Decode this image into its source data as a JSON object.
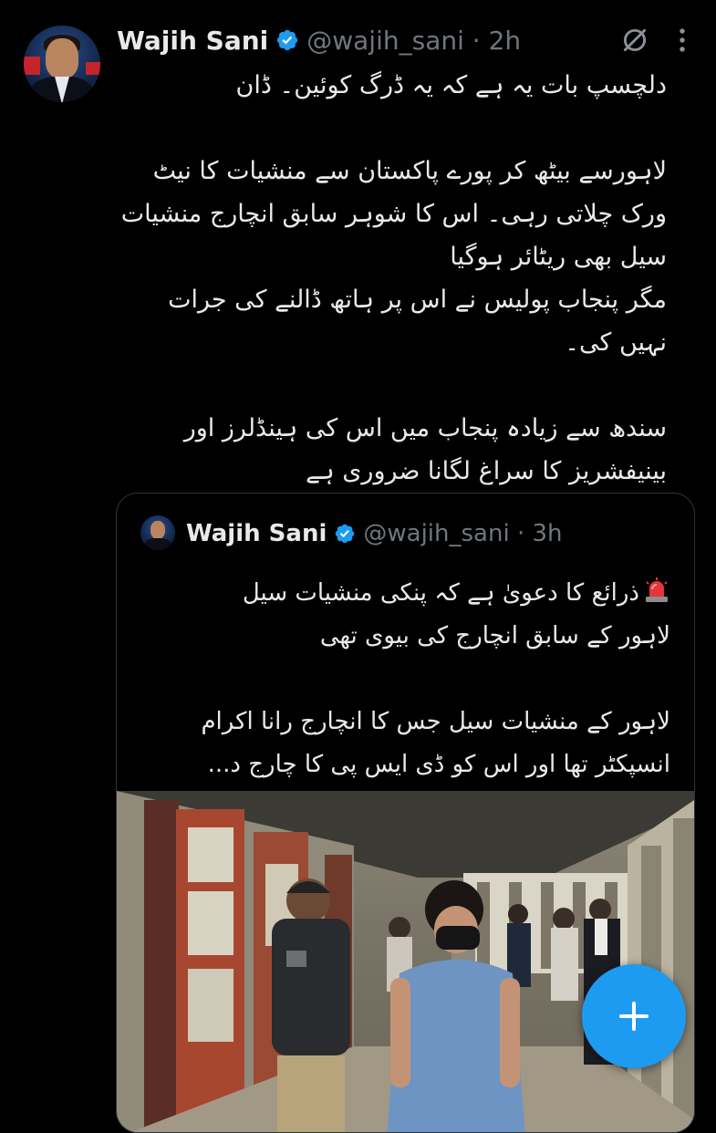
{
  "tweet": {
    "author_name": "Wajih Sani",
    "handle_time": "@wajih_sani · 2h",
    "body": [
      "دلچسپ بات یہ ہے کہ یہ ڈرگ کوئین۔ ڈان",
      "",
      "لاہورسے بیٹھ کر پورے پاکستان سے منشیات کا نیٹ",
      "ورک چلاتی رہی۔ اس کا شوہر سابق انچارج منشیات",
      "سیل بھی ریٹائر ہوگیا",
      "مگر پنجاب پولیس نے اس پر ہاتھ ڈالنے کی جرات",
      "نہیں کی۔",
      "",
      "سندھ سے زیادہ پنجاب میں اس کی ہینڈلرز اور",
      "بینیفشریز کا سراغ لگانا ضروری ہے"
    ]
  },
  "quoted": {
    "author_name": "Wajih Sani",
    "handle_time": "@wajih_sani · 3h",
    "body": [
      "ذرائع کا دعویٰ ہے کہ پنکی منشیات سیل",
      "لاہور کے سابق انچارج کی بیوی تھی",
      "",
      "لاہور کے منشیات سیل جس کا انچارج رانا اکرام",
      "انسپکٹر تھا اور اس کو ڈی ایس پی کا چارج د..."
    ],
    "siren_icon": "police-light-emoji"
  },
  "colors": {
    "background": "#000000",
    "text": "#e7e9ea",
    "muted": "#71767b",
    "accent": "#1d9bf0",
    "border": "#2f3336"
  },
  "icons": {
    "verified": "verified-badge-icon",
    "grok": "grok-icon",
    "more": "more-vertical-icon",
    "compose": "plus-icon"
  }
}
